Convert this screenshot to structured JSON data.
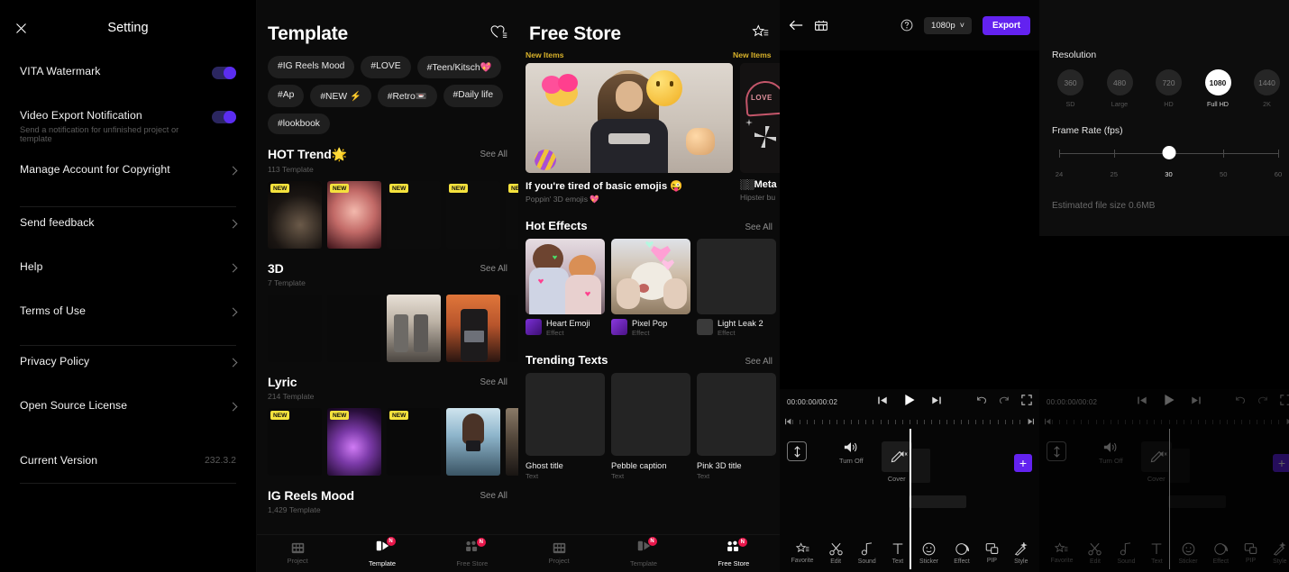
{
  "settings": {
    "title": "Setting",
    "close_icon": "close-icon",
    "rows": [
      {
        "label": "VITA Watermark",
        "sub": "",
        "type": "toggle",
        "on": true
      },
      {
        "label": "Video Export Notification",
        "sub": "Send a notification for unfinished project or template",
        "type": "toggle",
        "on": true
      },
      {
        "label": "Manage Account for Copyright",
        "sub": "",
        "type": "chevron"
      },
      {
        "label": "Send feedback",
        "sub": "",
        "type": "chevron"
      },
      {
        "label": "Help",
        "sub": "",
        "type": "chevron"
      },
      {
        "label": "Terms of Use",
        "sub": "",
        "type": "chevron"
      },
      {
        "label": "Privacy Policy",
        "sub": "",
        "type": "chevron"
      },
      {
        "label": "Open Source License",
        "sub": "",
        "type": "chevron"
      }
    ],
    "version_label": "Current Version",
    "version_value": "232.3.2"
  },
  "template": {
    "title": "Template",
    "favorite_icon": "heart-list-icon",
    "chips": [
      "#IG Reels Mood",
      "#LOVE",
      "#Teen/Kitsch💖",
      "#Ap",
      "#NEW ⚡",
      "#Retro📼",
      "#Daily life",
      "#lookbook"
    ],
    "sections": [
      {
        "title": "HOT Trend🌟",
        "count": "113 Template",
        "see_all": "See All",
        "cards": [
          {
            "new": true,
            "art": "photo-dark"
          },
          {
            "new": true,
            "art": "photo-face"
          },
          {
            "new": true,
            "art": "dark"
          },
          {
            "new": true,
            "art": "dark"
          },
          {
            "new": true,
            "art": "dark"
          }
        ]
      },
      {
        "title": "3D",
        "count": "7 Template",
        "see_all": "See All",
        "cards": [
          {
            "new": false,
            "art": "dark"
          },
          {
            "new": false,
            "art": "dark"
          },
          {
            "new": false,
            "art": "photo-duo"
          },
          {
            "new": false,
            "art": "photo-orange"
          },
          {
            "new": false,
            "art": "dark"
          }
        ]
      },
      {
        "title": "Lyric",
        "count": "214 Template",
        "see_all": "See All",
        "cards": [
          {
            "new": true,
            "art": "dark"
          },
          {
            "new": true,
            "art": "photo-neon"
          },
          {
            "new": true,
            "art": "dark"
          },
          {
            "new": false,
            "art": "photo-blue"
          },
          {
            "new": false,
            "art": "photo-room"
          }
        ]
      },
      {
        "title": "IG Reels Mood",
        "count": "1,429 Template",
        "see_all": "See All",
        "cards": []
      }
    ],
    "nav": [
      {
        "label": "Project",
        "icon": "film-grid-icon",
        "active": false,
        "badge": ""
      },
      {
        "label": "Template",
        "icon": "template-play-icon",
        "active": true,
        "badge": "N"
      },
      {
        "label": "Free Store",
        "icon": "store-icon",
        "active": false,
        "badge": "N"
      }
    ]
  },
  "store": {
    "title": "Free Store",
    "favorite_icon": "star-list-icon",
    "new_items_label": "New Items",
    "hero": {
      "title": "If you're tired of basic emojis 😜",
      "sub": "Poppin' 3D emojis 💖"
    },
    "hero2": {
      "new_items_label": "New Items",
      "title": "░░Meta",
      "sub": "Hipster bu"
    },
    "sections": [
      {
        "title": "Hot Effects",
        "see_all": "See All",
        "items": [
          {
            "name": "Heart Emoji",
            "kind": "Effect",
            "art": "photo-couple"
          },
          {
            "name": "Pixel Pop",
            "kind": "Effect",
            "art": "photo-cat"
          },
          {
            "name": "Light Leak 2",
            "kind": "Effect",
            "art": "blank"
          }
        ]
      },
      {
        "title": "Trending Texts",
        "see_all": "See All",
        "items": [
          {
            "name": "Ghost title",
            "kind": "Text",
            "art": "blank"
          },
          {
            "name": "Pebble caption",
            "kind": "Text",
            "art": "blank"
          },
          {
            "name": "Pink 3D title",
            "kind": "Text",
            "art": "blank"
          }
        ]
      }
    ],
    "nav": [
      {
        "label": "Project",
        "icon": "film-grid-icon",
        "active": false,
        "badge": ""
      },
      {
        "label": "Template",
        "icon": "template-play-icon",
        "active": false,
        "badge": "N"
      },
      {
        "label": "Free Store",
        "icon": "store-icon",
        "active": true,
        "badge": "N"
      }
    ]
  },
  "editor": {
    "back_icon": "back-arrow-icon",
    "grid_icon": "storyboard-icon",
    "help_icon": "help-circle-icon",
    "resolution_pill": "1080p",
    "resolution_chevron_down": "˅",
    "resolution_chevron_up": "˄",
    "export_label": "Export",
    "timeline": {
      "time": "00:00:00/00:02",
      "prev_icon": "skip-prev-icon",
      "play_icon": "play-icon",
      "next_icon": "skip-next-icon",
      "undo_icon": "undo-icon",
      "redo_icon": "redo-icon",
      "fullscreen_icon": "fullscreen-icon",
      "expand_icon": "expand-tracks-icon",
      "sound_label": "Turn Off",
      "sound_icon": "speaker-icon",
      "cover_label": "Cover",
      "cover_icon": "pencil-icon",
      "add_label": "+"
    },
    "tools": [
      {
        "label": "Favorite",
        "icon": "star-list-icon"
      },
      {
        "label": "Edit",
        "icon": "scissors-icon"
      },
      {
        "label": "Sound",
        "icon": "music-note-icon"
      },
      {
        "label": "Text",
        "icon": "text-t-icon"
      },
      {
        "label": "Sticker",
        "icon": "smiley-icon"
      },
      {
        "label": "Effect",
        "icon": "effect-swirl-icon"
      },
      {
        "label": "PIP",
        "icon": "pip-icon"
      },
      {
        "label": "Style",
        "icon": "magic-wand-icon"
      }
    ]
  },
  "export_sheet": {
    "resolution_title": "Resolution",
    "resolutions": [
      {
        "value": "360",
        "sub": "SD",
        "selected": false
      },
      {
        "value": "480",
        "sub": "Large",
        "selected": false
      },
      {
        "value": "720",
        "sub": "HD",
        "selected": false
      },
      {
        "value": "1080",
        "sub": "Full HD",
        "selected": true
      },
      {
        "value": "1440",
        "sub": "2K",
        "selected": false
      }
    ],
    "fps_title": "Frame Rate (fps)",
    "fps_ticks": [
      "24",
      "25",
      "30",
      "50",
      "60"
    ],
    "fps_value": "30",
    "est_label": "Estimated file size",
    "est_value": "0.6MB"
  },
  "colors": {
    "accent": "#6322f0",
    "badge_new": "#f5e23d",
    "badge_dot": "#e8174b",
    "new_items": "#d9b22a"
  }
}
